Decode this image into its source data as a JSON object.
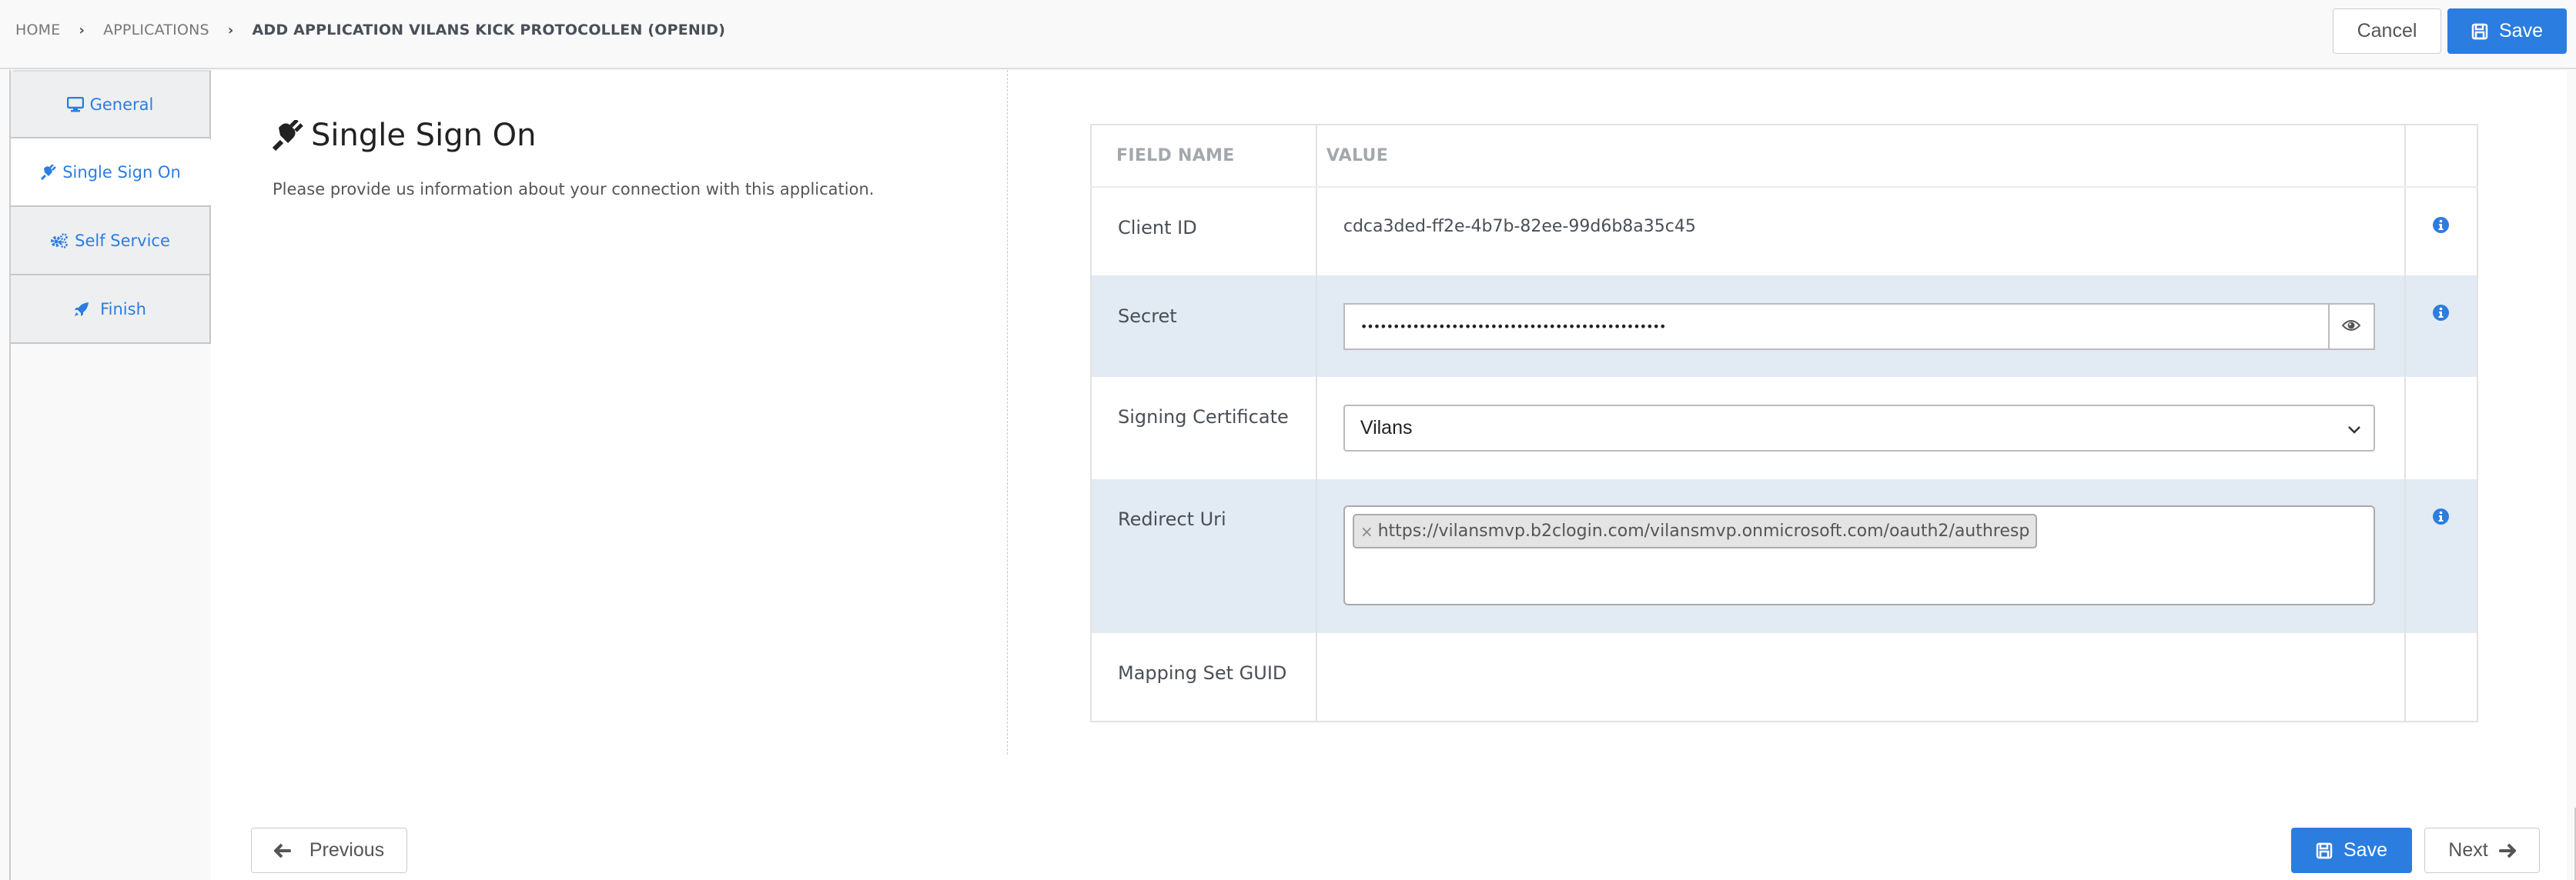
{
  "breadcrumb": {
    "items": [
      "HOME",
      "APPLICATIONS"
    ],
    "current": "ADD APPLICATION VILANS KICK PROTOCOLLEN (OPENID)"
  },
  "header_actions": {
    "cancel_label": "Cancel",
    "save_label": "Save"
  },
  "wizard": {
    "steps": [
      {
        "label": "General",
        "icon": "desktop-icon",
        "active": false
      },
      {
        "label": "Single Sign On",
        "icon": "plug-icon",
        "active": true
      },
      {
        "label": "Self Service",
        "icon": "cogs-icon",
        "active": false
      },
      {
        "label": "Finish",
        "icon": "rocket-icon",
        "active": false
      }
    ]
  },
  "section": {
    "title": "Single Sign On",
    "icon": "plug-icon",
    "description": "Please provide us information about your connection with this application."
  },
  "table": {
    "headers": [
      "FIELD NAME",
      "VALUE",
      ""
    ],
    "rows": {
      "client_id": {
        "label": "Client ID",
        "value": "cdca3ded-ff2e-4b7b-82ee-99d6b8a35c45",
        "has_info": true
      },
      "secret": {
        "label": "Secret",
        "masked_value": "•••••••••••••••••••••••••••••••••••••••••••••••",
        "has_info": true
      },
      "signing_certificate": {
        "label": "Signing Certificate",
        "selected": "Vilans",
        "has_info": false
      },
      "redirect_uri": {
        "label": "Redirect Uri",
        "tags": [
          "https://vilansmvp.b2clogin.com/vilansmvp.onmicrosoft.com/oauth2/authresp"
        ],
        "tag_remove": "×",
        "has_info": true
      },
      "mapping_set_guid": {
        "label": "Mapping Set GUID",
        "value": "",
        "has_info": false
      }
    }
  },
  "footer": {
    "previous_label": "Previous",
    "save_label": "Save",
    "next_label": "Next"
  },
  "colors": {
    "primary": "#2b7de0",
    "row_alt": "#e2eaf3",
    "sidebar_step_bg": "#eeeff1"
  }
}
